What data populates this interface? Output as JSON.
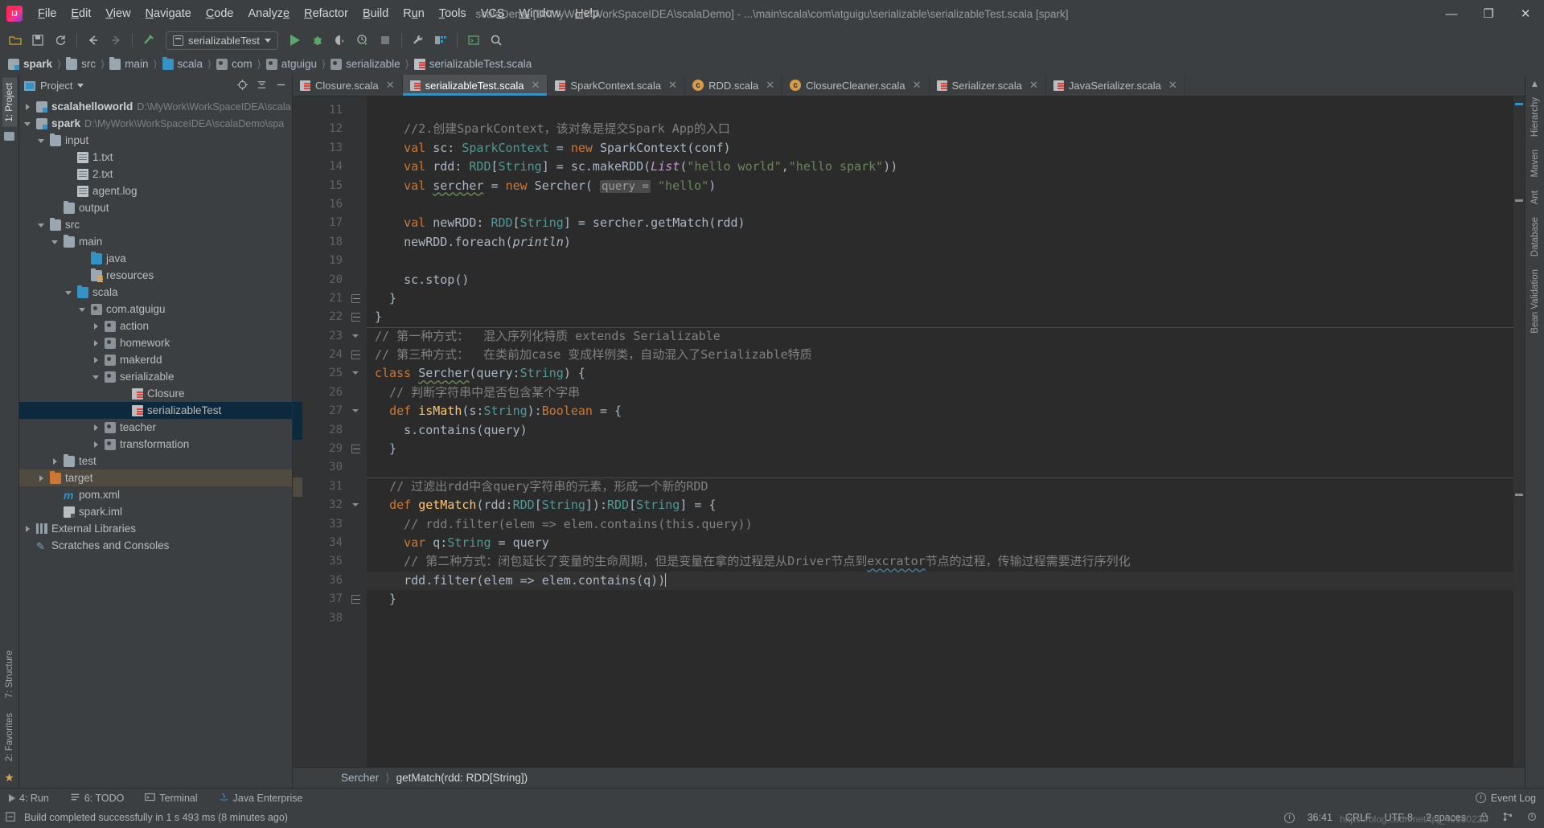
{
  "titlebar": {
    "menus": [
      "File",
      "Edit",
      "View",
      "Navigate",
      "Code",
      "Analyze",
      "Refactor",
      "Build",
      "Run",
      "Tools",
      "VCS",
      "Window",
      "Help"
    ],
    "window_title": "scalaDemo [D:\\MyWork\\WorkSpaceIDEA\\scalaDemo] - ...\\main\\scala\\com\\atguigu\\serializable\\serializableTest.scala [spark]",
    "minimize": "—",
    "maximize": "❐",
    "close": "✕"
  },
  "toolbar": {
    "icons": [
      "open-folder-icon",
      "save-icon",
      "sync-icon",
      "back-icon",
      "forward-icon",
      "build-icon"
    ],
    "run_config": "serializableTest",
    "run_icons": [
      "run-icon",
      "debug-icon",
      "run-coverage-icon",
      "profile-icon",
      "stop-icon",
      "settings-wrench-icon",
      "project-structure-icon",
      "terminal-icon",
      "search-icon"
    ]
  },
  "breadcrumb": [
    {
      "label": "spark",
      "icon": "module-icon"
    },
    {
      "label": "src",
      "icon": "folder-icon"
    },
    {
      "label": "main",
      "icon": "folder-icon"
    },
    {
      "label": "scala",
      "icon": "source-folder-icon"
    },
    {
      "label": "com",
      "icon": "package-icon"
    },
    {
      "label": "atguigu",
      "icon": "package-icon"
    },
    {
      "label": "serializable",
      "icon": "package-icon"
    },
    {
      "label": "serializableTest.scala",
      "icon": "scala-file-icon"
    }
  ],
  "left_strip": {
    "project_tab": "1: Project",
    "structure_tab": "7: Structure",
    "favorites_tab": "2: Favorites"
  },
  "right_strip": {
    "tabs": [
      "Hierarchy",
      "Maven",
      "Ant",
      "Database",
      "Bean Validation"
    ]
  },
  "project_panel": {
    "title": "Project",
    "tree": [
      {
        "indent": 0,
        "arrow": "right",
        "icon": "module-icon",
        "label": "scalahelloworld",
        "bold": true,
        "path": "D:\\MyWork\\WorkSpaceIDEA\\scala"
      },
      {
        "indent": 0,
        "arrow": "down",
        "icon": "module-icon",
        "label": "spark",
        "bold": true,
        "path": "D:\\MyWork\\WorkSpaceIDEA\\scalaDemo\\spa"
      },
      {
        "indent": 1,
        "arrow": "down",
        "icon": "folder-icon",
        "label": "input",
        "bold": false,
        "path": ""
      },
      {
        "indent": 3,
        "arrow": "none",
        "icon": "text-file-icon",
        "label": "1.txt",
        "bold": false,
        "path": ""
      },
      {
        "indent": 3,
        "arrow": "none",
        "icon": "text-file-icon",
        "label": "2.txt",
        "bold": false,
        "path": ""
      },
      {
        "indent": 3,
        "arrow": "none",
        "icon": "text-file-icon",
        "label": "agent.log",
        "bold": false,
        "path": ""
      },
      {
        "indent": 2,
        "arrow": "none",
        "icon": "folder-icon",
        "label": "output",
        "bold": false,
        "path": ""
      },
      {
        "indent": 1,
        "arrow": "down",
        "icon": "folder-icon",
        "label": "src",
        "bold": false,
        "path": ""
      },
      {
        "indent": 2,
        "arrow": "down",
        "icon": "folder-icon",
        "label": "main",
        "bold": false,
        "path": ""
      },
      {
        "indent": 4,
        "arrow": "none",
        "icon": "source-folder-icon",
        "label": "java",
        "bold": false,
        "path": ""
      },
      {
        "indent": 4,
        "arrow": "none",
        "icon": "resources-folder-icon",
        "label": "resources",
        "bold": false,
        "path": ""
      },
      {
        "indent": 3,
        "arrow": "down",
        "icon": "source-folder-icon",
        "label": "scala",
        "bold": false,
        "path": ""
      },
      {
        "indent": 4,
        "arrow": "down",
        "icon": "package-icon",
        "label": "com.atguigu",
        "bold": false,
        "path": ""
      },
      {
        "indent": 5,
        "arrow": "right",
        "icon": "package-icon",
        "label": "action",
        "bold": false,
        "path": ""
      },
      {
        "indent": 5,
        "arrow": "right",
        "icon": "package-icon",
        "label": "homework",
        "bold": false,
        "path": ""
      },
      {
        "indent": 5,
        "arrow": "right",
        "icon": "package-icon",
        "label": "makerdd",
        "bold": false,
        "path": ""
      },
      {
        "indent": 5,
        "arrow": "down",
        "icon": "package-icon",
        "label": "serializable",
        "bold": false,
        "path": ""
      },
      {
        "indent": 7,
        "arrow": "none",
        "icon": "scala-file-icon",
        "label": "Closure",
        "bold": false,
        "path": ""
      },
      {
        "indent": 7,
        "arrow": "none",
        "icon": "scala-file-icon",
        "label": "serializableTest",
        "bold": false,
        "path": "",
        "selected": true
      },
      {
        "indent": 5,
        "arrow": "right",
        "icon": "package-icon",
        "label": "teacher",
        "bold": false,
        "path": ""
      },
      {
        "indent": 5,
        "arrow": "right",
        "icon": "package-icon",
        "label": "transformation",
        "bold": false,
        "path": ""
      },
      {
        "indent": 2,
        "arrow": "right",
        "icon": "folder-icon",
        "label": "test",
        "bold": false,
        "path": ""
      },
      {
        "indent": 1,
        "arrow": "right",
        "icon": "target-folder-icon",
        "label": "target",
        "bold": false,
        "path": "",
        "highlight": true
      },
      {
        "indent": 2,
        "arrow": "none",
        "icon": "maven-icon",
        "label": "pom.xml",
        "bold": false,
        "path": ""
      },
      {
        "indent": 2,
        "arrow": "none",
        "icon": "iml-file-icon",
        "label": "spark.iml",
        "bold": false,
        "path": ""
      },
      {
        "indent": 0,
        "arrow": "right",
        "icon": "library-icon",
        "label": "External Libraries",
        "bold": false,
        "path": ""
      },
      {
        "indent": 0,
        "arrow": "none",
        "icon": "scratches-icon",
        "label": "Scratches and Consoles",
        "bold": false,
        "path": ""
      }
    ]
  },
  "editor_tabs": [
    {
      "label": "Closure.scala",
      "icon": "scala-file-icon",
      "active": false
    },
    {
      "label": "serializableTest.scala",
      "icon": "scala-file-icon",
      "active": true
    },
    {
      "label": "SparkContext.scala",
      "icon": "scala-file-icon",
      "active": false
    },
    {
      "label": "RDD.scala",
      "icon": "scala-class-icon",
      "active": false
    },
    {
      "label": "ClosureCleaner.scala",
      "icon": "scala-class-icon",
      "active": false
    },
    {
      "label": "Serializer.scala",
      "icon": "scala-file-icon",
      "active": false
    },
    {
      "label": "JavaSerializer.scala",
      "icon": "scala-file-icon",
      "active": false
    }
  ],
  "code": {
    "first_line_number": 11,
    "last_line_number": 38,
    "current_line": 36,
    "lines": [
      {
        "n": 11,
        "text": ""
      },
      {
        "n": 12,
        "text": "    //2.创建SparkContext，该对象是提交Spark App的入口"
      },
      {
        "n": 13,
        "text": "    val sc: SparkContext = new SparkContext(conf)"
      },
      {
        "n": 14,
        "text": "    val rdd: RDD[String] = sc.makeRDD(List(\"hello world\",\"hello spark\"))"
      },
      {
        "n": 15,
        "text": "    val sercher = new Sercher( query = \"hello\")"
      },
      {
        "n": 16,
        "text": ""
      },
      {
        "n": 17,
        "text": "    val newRDD: RDD[String] = sercher.getMatch(rdd)"
      },
      {
        "n": 18,
        "text": "    newRDD.foreach(println)"
      },
      {
        "n": 19,
        "text": ""
      },
      {
        "n": 20,
        "text": "    sc.stop()"
      },
      {
        "n": 21,
        "text": "  }"
      },
      {
        "n": 22,
        "text": "}"
      },
      {
        "n": 23,
        "text": "// 第一种方式：  混入序列化特质 extends Serializable"
      },
      {
        "n": 24,
        "text": "// 第三种方式：  在类前加case 变成样例类，自动混入了Serializable特质"
      },
      {
        "n": 25,
        "text": "class Sercher(query:String) {"
      },
      {
        "n": 26,
        "text": "  // 判断字符串中是否包含某个字串"
      },
      {
        "n": 27,
        "text": "  def isMath(s:String):Boolean = {"
      },
      {
        "n": 28,
        "text": "    s.contains(query)"
      },
      {
        "n": 29,
        "text": "  }"
      },
      {
        "n": 30,
        "text": ""
      },
      {
        "n": 31,
        "text": "  // 过滤出rdd中含query字符串的元素，形成一个新的RDD"
      },
      {
        "n": 32,
        "text": "  def getMatch(rdd:RDD[String]):RDD[String] = {"
      },
      {
        "n": 33,
        "text": "    // rdd.filter(elem => elem.contains(this.query))"
      },
      {
        "n": 34,
        "text": "    var q:String = query"
      },
      {
        "n": 35,
        "text": "    // 第二种方式：闭包延长了变量的生命周期，但是变量在拿的过程是从Driver节点到excrator节点的过程，传输过程需要进行序列化"
      },
      {
        "n": 36,
        "text": "    rdd.filter(elem => elem.contains(q))"
      },
      {
        "n": 37,
        "text": "  }"
      },
      {
        "n": 38,
        "text": ""
      }
    ]
  },
  "editor_breadcrumb": [
    {
      "label": "Sercher"
    },
    {
      "label": "getMatch(rdd: RDD[String])"
    }
  ],
  "bottom_tools": [
    {
      "label": "4: Run",
      "icon": "run-icon"
    },
    {
      "label": "6: TODO",
      "icon": "todo-icon"
    },
    {
      "label": "Terminal",
      "icon": "terminal-icon"
    },
    {
      "label": "Java Enterprise",
      "icon": "java-icon"
    }
  ],
  "status": {
    "message": "Build completed successfully in 1 s 493 ms (8 minutes ago)",
    "caret_position": "36:41",
    "line_separator": "CRLF",
    "encoding": "UTF-8",
    "indent": "2 spaces",
    "event_log": "Event Log",
    "watermark": "https://blog.csdn.net/qq_40180220"
  },
  "colors": {
    "accent_blue": "#3592c4",
    "selection": "#0d293e",
    "editor_bg": "#2b2b2b",
    "panel_bg": "#3c3f41",
    "run_green": "#59a869",
    "target_orange": "#cc7832"
  }
}
